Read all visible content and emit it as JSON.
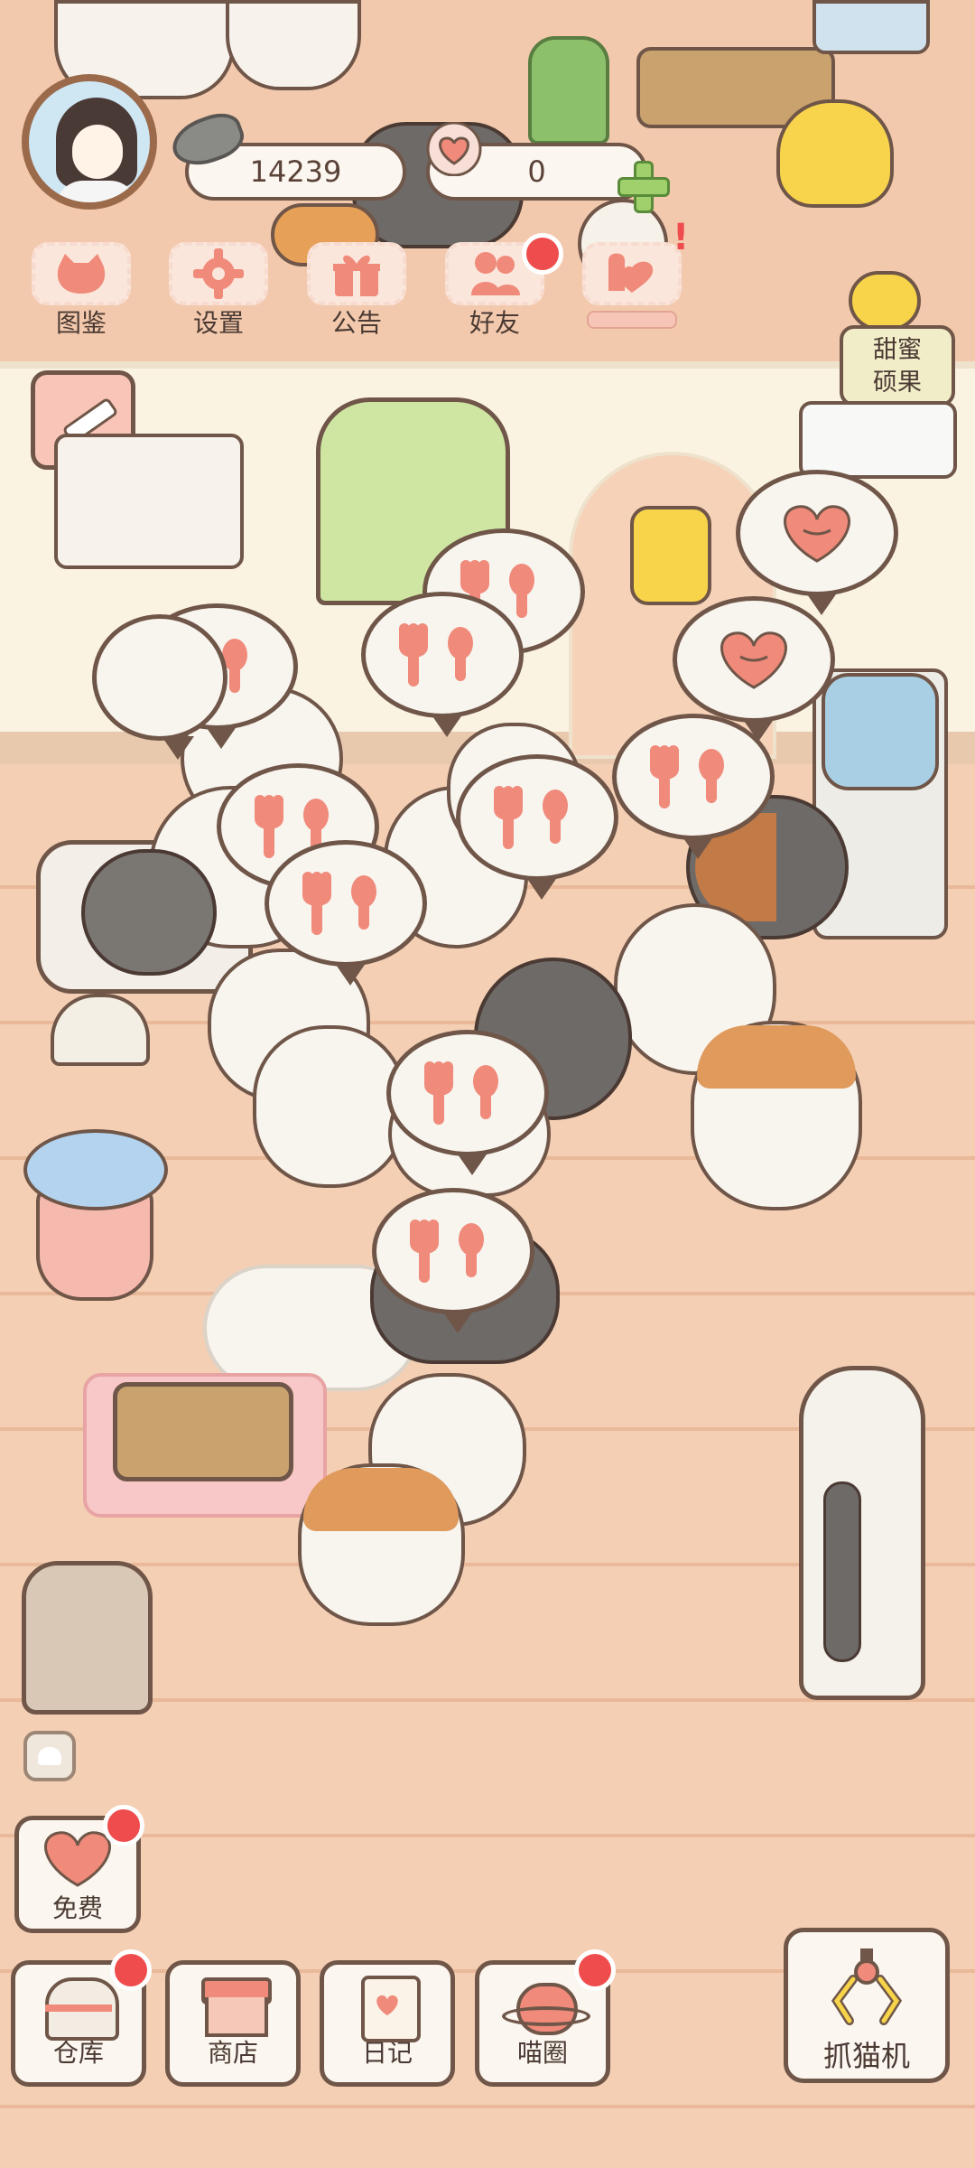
{
  "header": {
    "coins": "14239",
    "hearts": "0"
  },
  "top_menu": [
    {
      "label": "图鉴",
      "icon": "cat-face-icon"
    },
    {
      "label": "设置",
      "icon": "gear-icon"
    },
    {
      "label": "公告",
      "icon": "gift-icon"
    },
    {
      "label": "好友",
      "icon": "friends-icon"
    },
    {
      "label": "",
      "icon": "event-icon"
    }
  ],
  "side": {
    "sweet_nut_line1": "甜蜜",
    "sweet_nut_line2": "硕果"
  },
  "bottom": {
    "free_label": "免费",
    "warehouse_label": "仓库",
    "shop_label": "商店",
    "diary_label": "日记",
    "circle_label": "喵圈",
    "claw_label": "抓猫机"
  },
  "colors": {
    "accent_red": "#ef4d4d",
    "outline_brown": "#6f5648",
    "floor": "#f4cfb4",
    "wall": "#fbf3e2",
    "pink_icon": "#f08a7a"
  }
}
